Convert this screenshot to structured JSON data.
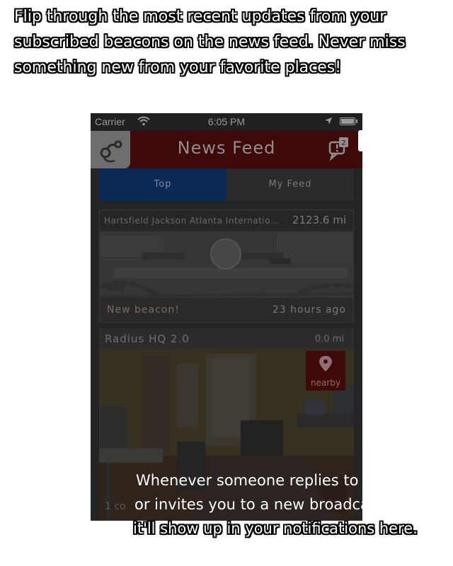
{
  "caption_top": [
    "Flip through the most recent updates from your",
    "subscribed beacons on the news feed. Never miss",
    "something new from your favorite places!"
  ],
  "status_bar": {
    "carrier": "Carrier",
    "time": "6:05 PM",
    "battery_level": 1.0
  },
  "nav": {
    "title": "News Feed",
    "notification_count": "2",
    "left_icon": "radius-logo-icon",
    "right_icon": "notification-icon"
  },
  "tabs": {
    "top": "Top",
    "my_feed": "My Feed",
    "active": "Top"
  },
  "cards": [
    {
      "title": "Hartsfield Jackson Atlanta Internation...",
      "distance": "2123.6 mi",
      "footer_left": "New beacon!",
      "footer_right": "23 hours ago",
      "image": "airport-map-image"
    },
    {
      "title": "Radius HQ 2.0",
      "distance": "0.0 mi",
      "badge": "nearby",
      "badge_icon": "location-pin-icon",
      "image": "office-room-photo",
      "comments": "1 co"
    }
  ],
  "caption_bottom": [
    "Whenever someone replies to you",
    "or invites you to a new broadcast,",
    "it'll show up in your notifications here."
  ],
  "colors": {
    "nav_bar": "#3d0909",
    "active_tab": "#0a2955",
    "overlay": "#000000"
  }
}
